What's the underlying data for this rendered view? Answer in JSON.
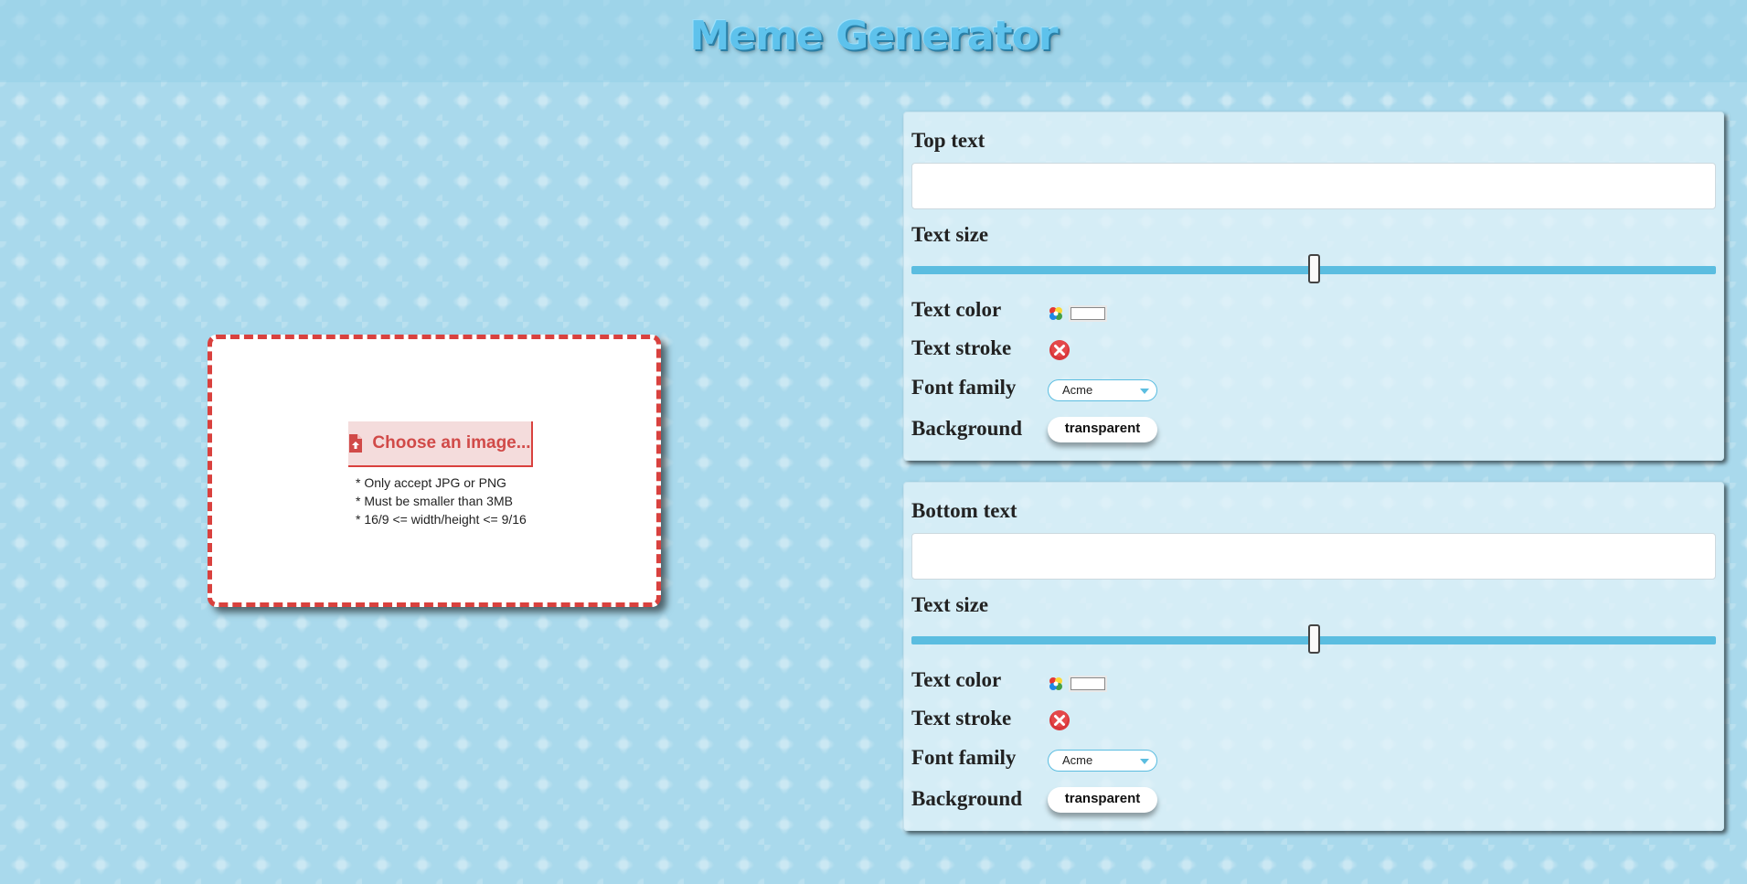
{
  "header": {
    "title": "Meme Generator"
  },
  "upload": {
    "button_label": "Choose an image...",
    "rules": [
      "* Only accept JPG or PNG",
      "* Must be smaller than 3MB",
      "* 16/9 <= width/height <= 9/16"
    ]
  },
  "top_panel": {
    "text_label": "Top text",
    "text_value": "",
    "size_label": "Text size",
    "size_value": 0.5,
    "color_label": "Text color",
    "color_value": "#ffffff",
    "stroke_label": "Text stroke",
    "font_label": "Font family",
    "font_value": "Acme",
    "background_label": "Background",
    "background_value": "transparent"
  },
  "bottom_panel": {
    "text_label": "Bottom text",
    "text_value": "",
    "size_label": "Text size",
    "size_value": 0.5,
    "color_label": "Text color",
    "color_value": "#ffffff",
    "stroke_label": "Text stroke",
    "font_label": "Font family",
    "font_value": "Acme",
    "background_label": "Background",
    "background_value": "transparent"
  },
  "icons": {
    "file": "file-upload-icon",
    "color_picker": "color-wheel-icon",
    "stroke_off": "close-circle-icon",
    "dropdown": "chevron-down-icon"
  },
  "colors": {
    "accent": "#5bbde0",
    "upload_border": "#d9413e",
    "stroke_off": "#d9363a",
    "title": "#5ec2ec"
  }
}
